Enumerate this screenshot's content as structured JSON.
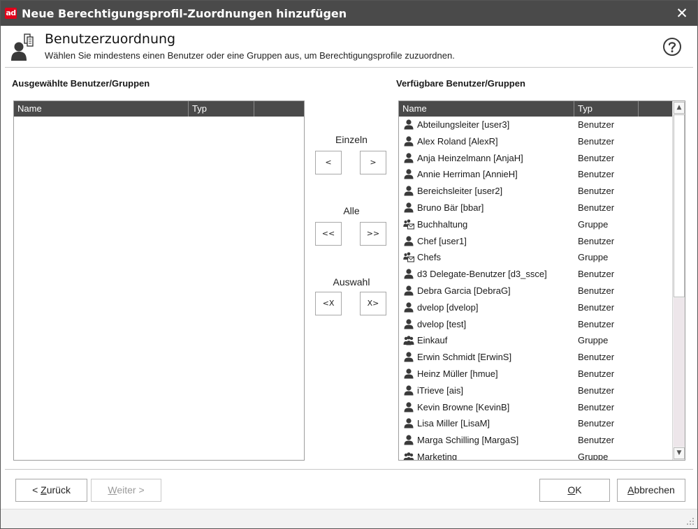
{
  "window": {
    "logo_text": "ad",
    "title": "Neue Berechtigungsprofil-Zuordnungen hinzufügen",
    "close_glyph": "✕"
  },
  "header": {
    "icon": "user-assign-icon",
    "title": "Benutzerzuordnung",
    "subtitle": "Wählen Sie mindestens einen Benutzer oder eine Gruppen aus, um Berechtigungsprofile zuzuordnen.",
    "help_icon": "help-circle-icon"
  },
  "selected": {
    "label": "Ausgewählte Benutzer/Gruppen",
    "columns": [
      "Name",
      "Typ",
      ""
    ],
    "rows": []
  },
  "available": {
    "label": "Verfügbare Benutzer/Gruppen",
    "columns": [
      "Name",
      "Typ",
      ""
    ],
    "rows": [
      {
        "name": "Abteilungsleiter [user3]",
        "type": "Benutzer",
        "icon": "user-icon"
      },
      {
        "name": "Alex Roland [AlexR]",
        "type": "Benutzer",
        "icon": "user-icon"
      },
      {
        "name": "Anja Heinzelmann [AnjaH]",
        "type": "Benutzer",
        "icon": "user-icon"
      },
      {
        "name": "Annie Herriman [AnnieH]",
        "type": "Benutzer",
        "icon": "user-icon"
      },
      {
        "name": "Bereichsleiter [user2]",
        "type": "Benutzer",
        "icon": "user-icon"
      },
      {
        "name": "Bruno Bär [bbar]",
        "type": "Benutzer",
        "icon": "user-icon"
      },
      {
        "name": "Buchhaltung",
        "type": "Gruppe",
        "icon": "mail-group-icon"
      },
      {
        "name": "Chef [user1]",
        "type": "Benutzer",
        "icon": "user-icon"
      },
      {
        "name": "Chefs",
        "type": "Gruppe",
        "icon": "mail-group-icon"
      },
      {
        "name": "d3 Delegate-Benutzer [d3_ssce]",
        "type": "Benutzer",
        "icon": "user-icon"
      },
      {
        "name": "Debra Garcia [DebraG]",
        "type": "Benutzer",
        "icon": "user-icon"
      },
      {
        "name": "dvelop [dvelop]",
        "type": "Benutzer",
        "icon": "user-icon"
      },
      {
        "name": "dvelop [test]",
        "type": "Benutzer",
        "icon": "user-icon"
      },
      {
        "name": "Einkauf",
        "type": "Gruppe",
        "icon": "group-icon"
      },
      {
        "name": "Erwin Schmidt [ErwinS]",
        "type": "Benutzer",
        "icon": "user-icon"
      },
      {
        "name": "Heinz Müller [hmue]",
        "type": "Benutzer",
        "icon": "user-icon"
      },
      {
        "name": "iTrieve [ais]",
        "type": "Benutzer",
        "icon": "user-icon"
      },
      {
        "name": "Kevin Browne [KevinB]",
        "type": "Benutzer",
        "icon": "user-icon"
      },
      {
        "name": "Lisa Miller [LisaM]",
        "type": "Benutzer",
        "icon": "user-icon"
      },
      {
        "name": "Marga Schilling [MargaS]",
        "type": "Benutzer",
        "icon": "user-icon"
      },
      {
        "name": "Marketing",
        "type": "Gruppe",
        "icon": "group-icon"
      }
    ],
    "scroll": {
      "up_glyph": "▲",
      "down_glyph": "▼"
    }
  },
  "move": {
    "single_label": "Einzeln",
    "single_left": "<",
    "single_right": ">",
    "all_label": "Alle",
    "all_left": "<<",
    "all_right": ">>",
    "selection_label": "Auswahl",
    "selection_left": "<X",
    "selection_right": "X>"
  },
  "footer": {
    "back_prefix": "< ",
    "back_mnemonic": "Z",
    "back_rest": "urück",
    "next_mnemonic": "W",
    "next_rest": "eiter >",
    "ok_mnemonic": "O",
    "ok_rest": "K",
    "cancel_mnemonic": "A",
    "cancel_rest": "bbrechen"
  },
  "colors": {
    "titlebar": "#4a4a4a",
    "table_header": "#4a4a4a",
    "brand_red": "#e2001a"
  }
}
